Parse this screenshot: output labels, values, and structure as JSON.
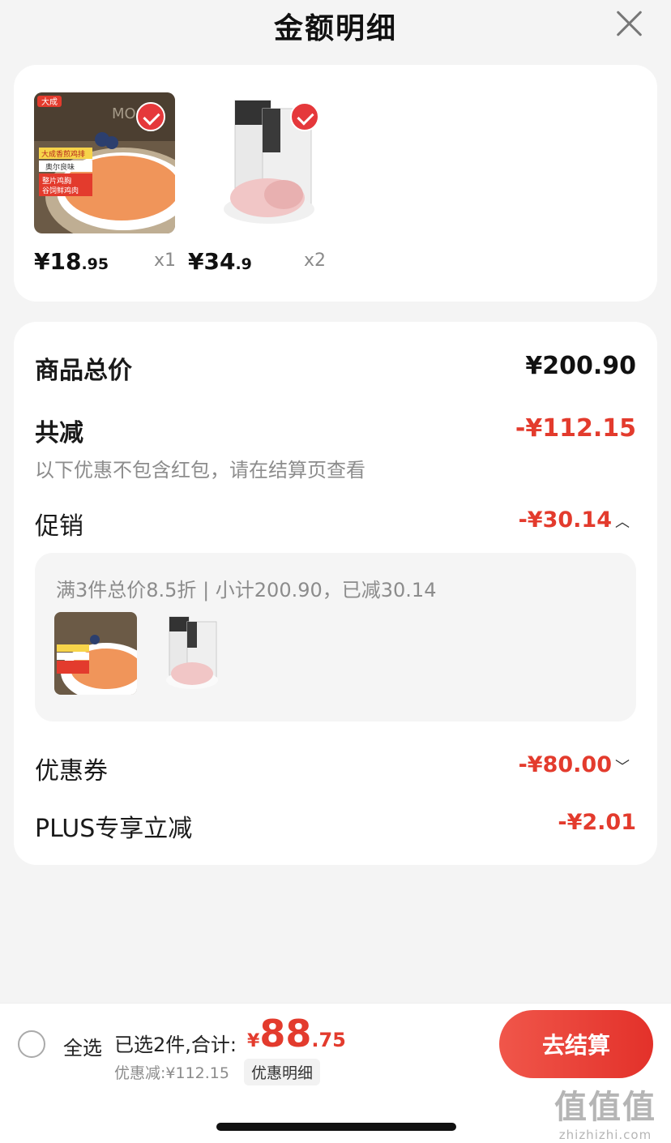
{
  "header": {
    "title": "金额明细"
  },
  "products": [
    {
      "price_int": "¥18",
      "price_dec": ".95",
      "qty": "x1"
    },
    {
      "price_int": "¥34",
      "price_dec": ".9",
      "qty": "x2"
    }
  ],
  "product_image_text": {
    "brand": "大成",
    "lines": [
      "大成香煎鸡排",
      "奥尔良味",
      "整片鸡胸",
      "谷饲鲜鸡肉"
    ],
    "background": "MOOD"
  },
  "summary": {
    "total_label": "商品总价",
    "total_value": "¥200.90",
    "reduce_label": "共减",
    "reduce_value": "-¥112.15",
    "note": "以下优惠不包含红包，请在结算页查看",
    "promo_label": "促销",
    "promo_value": "-¥30.14",
    "promo_detail": "满3件总价8.5折 | 小计200.90，已减30.14",
    "coupon_label": "优惠券",
    "coupon_value": "-¥80.00",
    "plus_label": "PLUS专享立减",
    "plus_value": "-¥2.01"
  },
  "bottom": {
    "select_all": "全选",
    "selected_text": "已选2件,合计:",
    "total_yen": "¥",
    "total_int": "88",
    "total_dec": ".75",
    "discount_text": "优惠减:¥112.15",
    "detail_link": "优惠明细",
    "checkout": "去结算"
  },
  "watermark": {
    "glyphs": "值值值",
    "site": "zhizhizhi.com"
  },
  "colors": {
    "accent": "#e33b2d",
    "check": "#e5383b",
    "background": "#f4f4f4"
  },
  "icons": {
    "close": "close-icon",
    "check": "check-icon",
    "chevron_up": "chevron-up-icon",
    "chevron_down": "chevron-down-icon"
  }
}
